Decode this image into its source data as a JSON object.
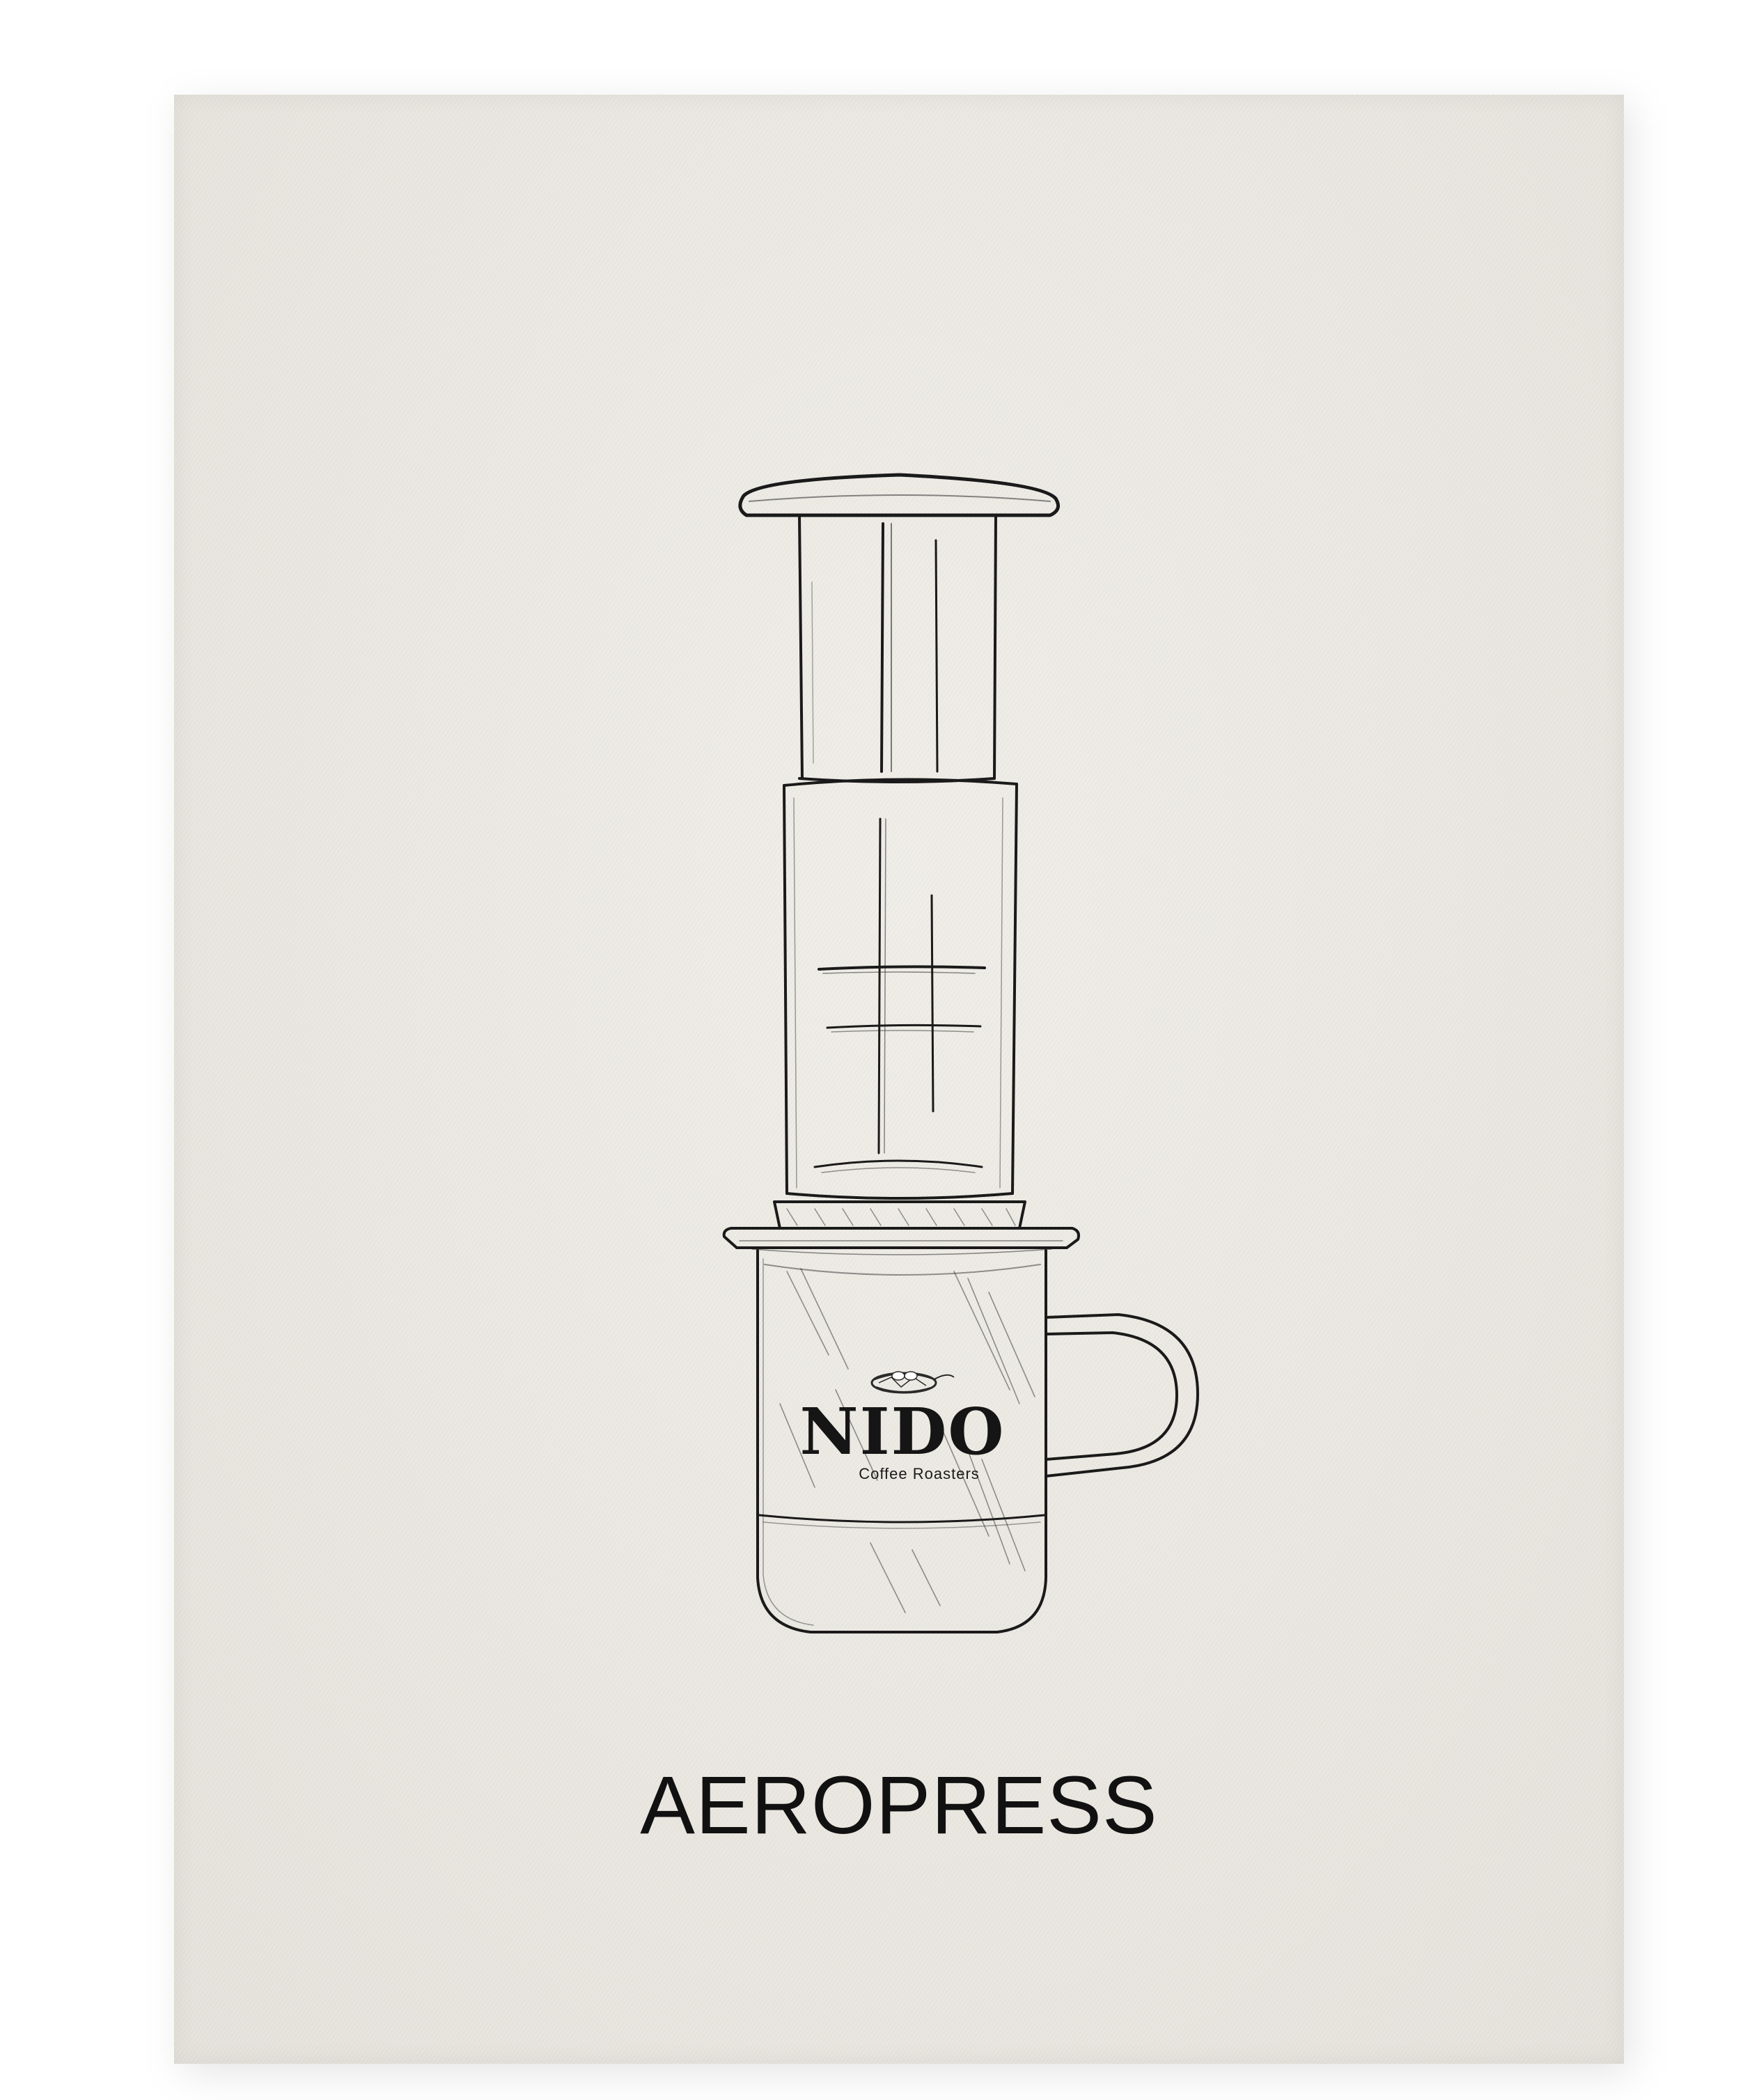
{
  "product_title": "AEROPRESS",
  "logo": {
    "brand": "NIDO",
    "tagline": "Coffee Roasters"
  },
  "icons": [
    "aeropress-illustration",
    "mug-illustration",
    "nest-icon"
  ],
  "colors": {
    "cloth": "#ece9e2",
    "ink": "#111111"
  }
}
